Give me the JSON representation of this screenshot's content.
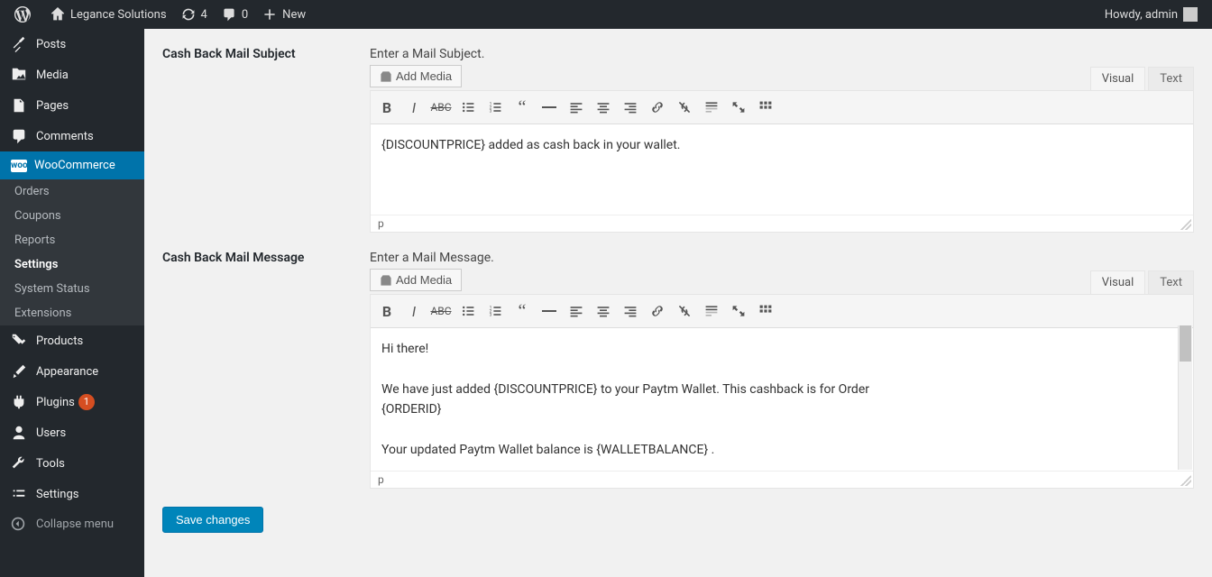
{
  "adminbar": {
    "site_name": "Legance Solutions",
    "updates_count": "4",
    "comments_count": "0",
    "new_label": "New",
    "howdy": "Howdy, admin"
  },
  "sidebar": {
    "items": [
      {
        "label": "Posts"
      },
      {
        "label": "Media"
      },
      {
        "label": "Pages"
      },
      {
        "label": "Comments"
      },
      {
        "label": "WooCommerce"
      },
      {
        "label": "Products"
      },
      {
        "label": "Appearance"
      },
      {
        "label": "Plugins",
        "badge": "1"
      },
      {
        "label": "Users"
      },
      {
        "label": "Tools"
      },
      {
        "label": "Settings"
      }
    ],
    "woo_submenu": [
      {
        "label": "Orders"
      },
      {
        "label": "Coupons"
      },
      {
        "label": "Reports"
      },
      {
        "label": "Settings"
      },
      {
        "label": "System Status"
      },
      {
        "label": "Extensions"
      }
    ],
    "collapse_label": "Collapse menu"
  },
  "form": {
    "subject": {
      "label": "Cash Back Mail Subject",
      "desc": "Enter a Mail Subject.",
      "add_media": "Add Media",
      "visual_tab": "Visual",
      "text_tab": "Text",
      "content": "{DISCOUNTPRICE} added as cash back in your wallet.",
      "status": "p"
    },
    "message": {
      "label": "Cash Back Mail Message",
      "desc": "Enter a Mail Message.",
      "add_media": "Add Media",
      "visual_tab": "Visual",
      "text_tab": "Text",
      "line1": "Hi there!",
      "line2": "We have just added {DISCOUNTPRICE} to your Paytm Wallet. This cashback is for Order",
      "line3": "{ORDERID}",
      "line4": "Your updated Paytm Wallet balance is {WALLETBALANCE} .",
      "status": "p"
    },
    "save_label": "Save changes"
  }
}
